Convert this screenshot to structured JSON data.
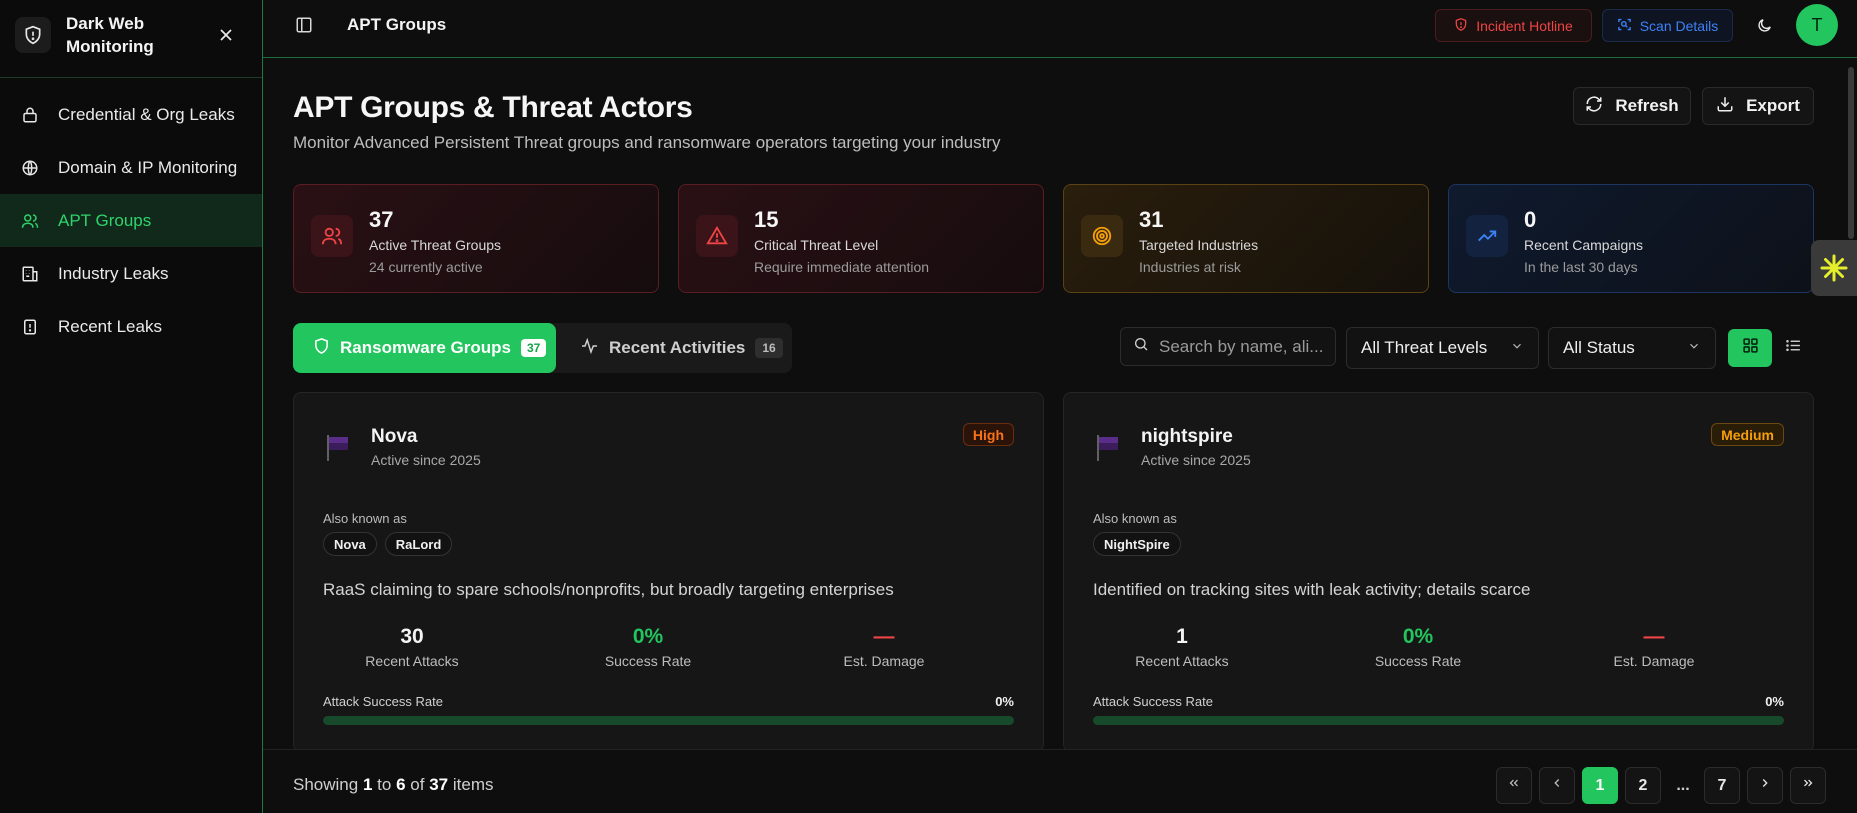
{
  "sidebar": {
    "title": "Dark Web Monitoring",
    "items": [
      {
        "label": "Credential & Org Leaks",
        "icon": "lock-icon"
      },
      {
        "label": "Domain & IP Monitoring",
        "icon": "globe-icon"
      },
      {
        "label": "APT Groups",
        "icon": "users-icon",
        "active": true
      },
      {
        "label": "Industry Leaks",
        "icon": "building-icon"
      },
      {
        "label": "Recent Leaks",
        "icon": "alert-file-icon"
      }
    ]
  },
  "topbar": {
    "title": "APT Groups",
    "hotline_label": "Incident Hotline",
    "scan_label": "Scan Details",
    "avatar_initial": "T"
  },
  "header": {
    "title": "APT Groups & Threat Actors",
    "subtitle": "Monitor Advanced Persistent Threat groups and ransomware operators targeting your industry",
    "refresh_label": "Refresh",
    "export_label": "Export"
  },
  "stats": [
    {
      "value": "37",
      "label": "Active Threat Groups",
      "sub": "24 currently active",
      "color": "#ef4444",
      "icon": "users-icon"
    },
    {
      "value": "15",
      "label": "Critical Threat Level",
      "sub": "Require immediate attention",
      "color": "#ef4444",
      "icon": "warning-icon"
    },
    {
      "value": "31",
      "label": "Targeted Industries",
      "sub": "Industries at risk",
      "color": "#f59e0b",
      "icon": "target-icon"
    },
    {
      "value": "0",
      "label": "Recent Campaigns",
      "sub": "In the last 30 days",
      "color": "#3b82f6",
      "icon": "trending-up-icon"
    }
  ],
  "tabs": [
    {
      "label": "Ransomware Groups",
      "count": "37",
      "active": true
    },
    {
      "label": "Recent Activities",
      "count": "16"
    }
  ],
  "filters": {
    "search_placeholder": "Search by name, ali...",
    "threat_level": "All Threat Levels",
    "status": "All Status"
  },
  "cards": [
    {
      "name": "Nova",
      "since": "Active since 2025",
      "level": "High",
      "aka_label": "Also known as",
      "aliases": [
        "Nova",
        "RaLord"
      ],
      "description": "RaaS claiming to spare schools/nonprofits, but broadly targeting enterprises",
      "attacks": "30",
      "attacks_label": "Recent Attacks",
      "success": "0%",
      "success_label": "Success Rate",
      "damage": "—",
      "damage_label": "Est. Damage",
      "asr_label": "Attack Success Rate",
      "asr_value": "0%",
      "asr_fraction": 0
    },
    {
      "name": "nightspire",
      "since": "Active since 2025",
      "level": "Medium",
      "aka_label": "Also known as",
      "aliases": [
        "NightSpire"
      ],
      "description": "Identified on tracking sites with leak activity; details scarce",
      "attacks": "1",
      "attacks_label": "Recent Attacks",
      "success": "0%",
      "success_label": "Success Rate",
      "damage": "—",
      "damage_label": "Est. Damage",
      "asr_label": "Attack Success Rate",
      "asr_value": "0%",
      "asr_fraction": 0
    }
  ],
  "footer": {
    "showing": "Showing",
    "from": "1",
    "to_word": "to",
    "to": "6",
    "of_word": "of",
    "total": "37",
    "items_word": "items",
    "pages": [
      "1",
      "2",
      "...",
      "7"
    ]
  },
  "colors": {
    "accent": "#22c55e",
    "danger": "#ef4444",
    "warning": "#f59e0b",
    "info": "#3b82f6"
  }
}
